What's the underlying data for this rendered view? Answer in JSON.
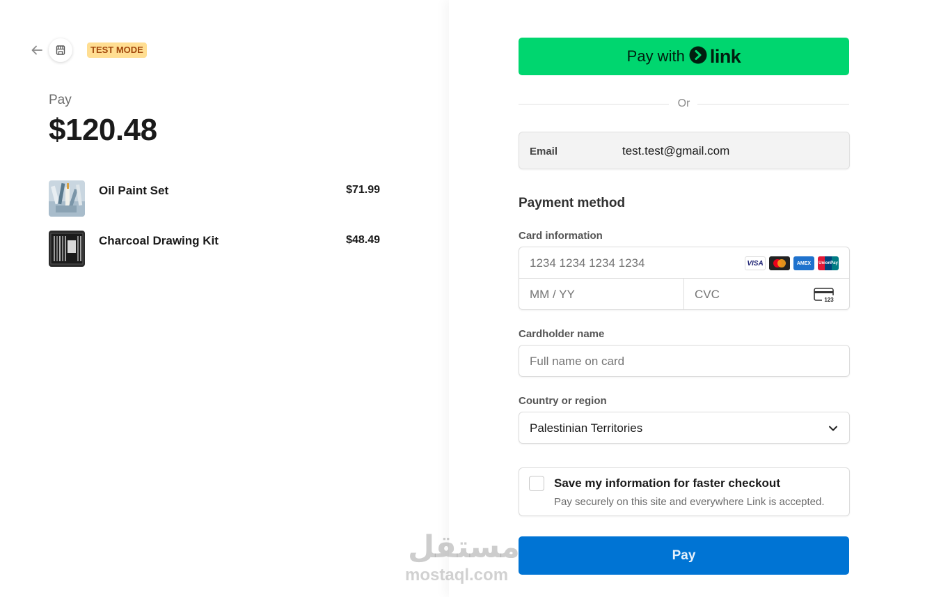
{
  "header": {
    "badge": "TEST MODE"
  },
  "summary": {
    "pay_label": "Pay",
    "amount": "$120.48",
    "items": [
      {
        "name": "Oil Paint Set",
        "price": "$71.99"
      },
      {
        "name": "Charcoal Drawing Kit",
        "price": "$48.49"
      }
    ]
  },
  "checkout": {
    "link_button": {
      "prefix": "Pay with",
      "brand": "link"
    },
    "divider": "Or",
    "email": {
      "label": "Email",
      "value": "test.test@gmail.com"
    },
    "payment_method_title": "Payment method",
    "card": {
      "label": "Card information",
      "number_placeholder": "1234 1234 1234 1234",
      "expiry_placeholder": "MM / YY",
      "cvc_placeholder": "CVC",
      "brands": [
        "VISA",
        "mastercard",
        "AMEX",
        "UnionPay"
      ],
      "cvc_icon_text": "123"
    },
    "cardholder": {
      "label": "Cardholder name",
      "placeholder": "Full name on card"
    },
    "country": {
      "label": "Country or region",
      "value": "Palestinian Territories"
    },
    "save_info": {
      "title": "Save my information for faster checkout",
      "subtitle": "Pay securely on this site and everywhere Link is accepted."
    },
    "pay_button": "Pay"
  },
  "watermark": {
    "arabic": "مستقل",
    "latin": "mostaql.com"
  },
  "colors": {
    "link_green": "#00d66f",
    "pay_blue": "#0074d4",
    "test_badge_bg": "#ffde92",
    "test_badge_text": "#a2470b"
  }
}
